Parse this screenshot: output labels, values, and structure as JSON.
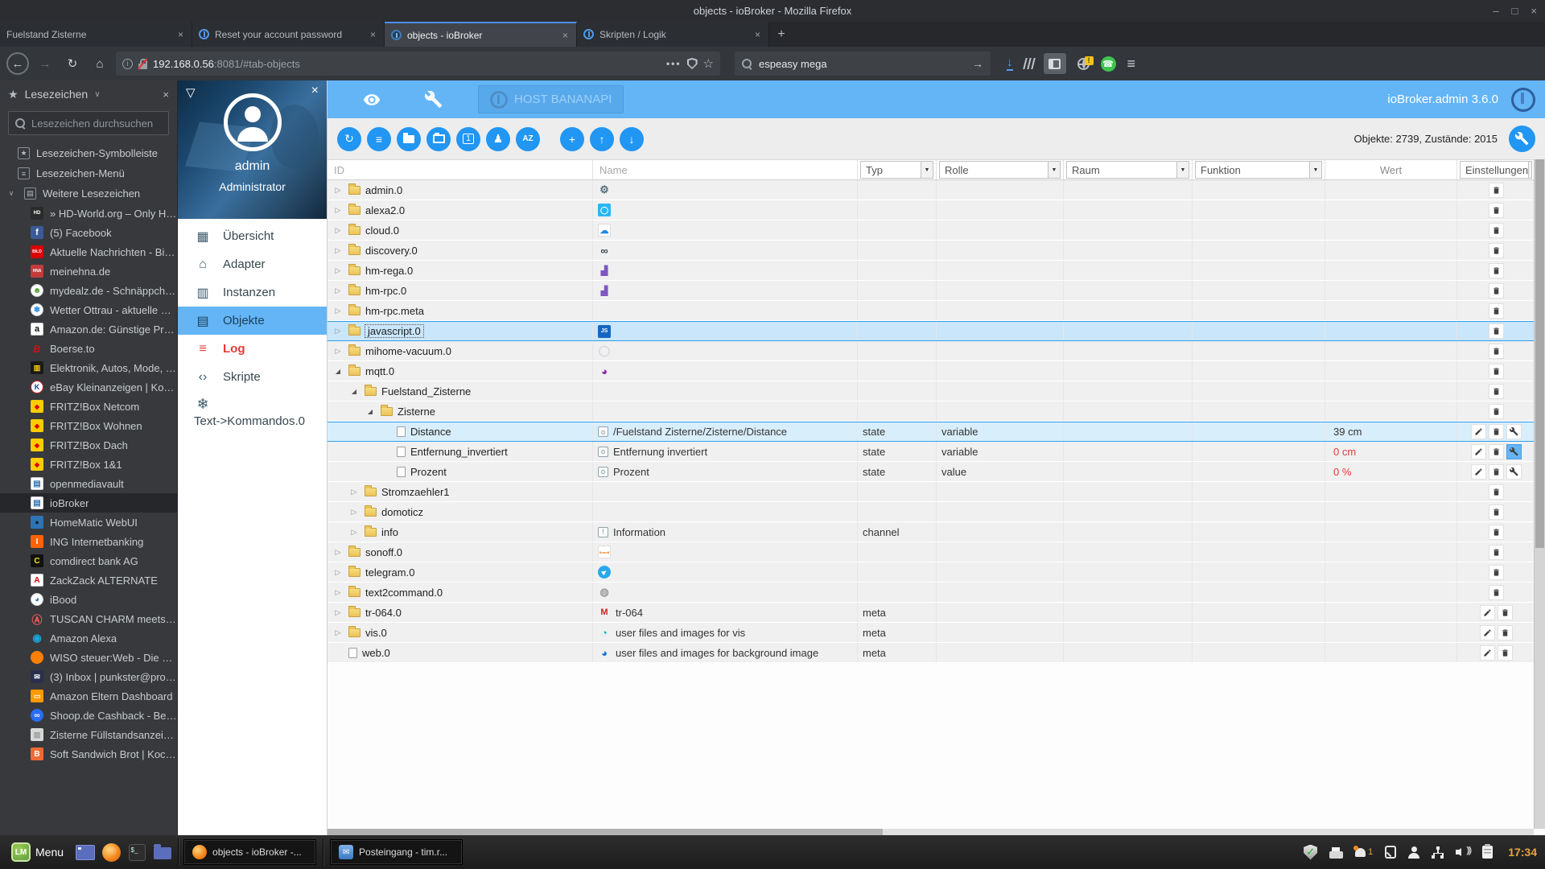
{
  "window": {
    "title": "objects - ioBroker - Mozilla Firefox",
    "controls": {
      "minimize": "–",
      "maximize": "□",
      "close": "×"
    }
  },
  "tabs": [
    {
      "label": "Fuelstand Zisterne",
      "favicon": "none",
      "active": false
    },
    {
      "label": "Reset your account password",
      "favicon": "circle-i-icon",
      "active": false
    },
    {
      "label": "objects - ioBroker",
      "favicon": "iobroker-icon",
      "active": true
    },
    {
      "label": "Skripten / Logik",
      "favicon": "circle-i-icon",
      "active": false
    }
  ],
  "navbar": {
    "url_host": "192.168.0.56",
    "url_rest": ":8081/#tab-objects",
    "search_value": "espeasy mega"
  },
  "bookmarks": {
    "title": "Lesezeichen",
    "search_placeholder": "Lesezeichen durchsuchen",
    "roots": [
      {
        "label": "Lesezeichen-Symbolleiste",
        "icon": "bookmarks-toolbar-icon",
        "glyph": "★",
        "expanded": false
      },
      {
        "label": "Lesezeichen-Menü",
        "icon": "bookmarks-menu-icon",
        "glyph": "≡",
        "expanded": false
      },
      {
        "label": "Weitere Lesezeichen",
        "icon": "other-bookmarks-icon",
        "glyph": "▤",
        "expanded": true
      }
    ],
    "items": [
      {
        "label": "» HD-World.org – Only Hig...",
        "icon": "hdworld-favicon",
        "glyph": "HD",
        "bg": "#2b2b2b",
        "fg": "#ffffff",
        "fs": 6
      },
      {
        "label": "(5) Facebook",
        "icon": "facebook-favicon",
        "glyph": "f",
        "bg": "#3a5a98",
        "fg": "#ffffff",
        "fs": 11
      },
      {
        "label": "Aktuelle Nachrichten - Bild...",
        "icon": "bild-favicon",
        "glyph": "BILD",
        "bg": "#dd0000",
        "fg": "#ffffff",
        "fs": 5
      },
      {
        "label": "meinehna.de",
        "icon": "hna-favicon",
        "glyph": "HNA",
        "bg": "#c23a3a",
        "fg": "#ffffff",
        "fs": 5
      },
      {
        "label": "mydealz.de - Schnäppchen...",
        "icon": "mydealz-favicon",
        "glyph": "☻",
        "bg": "#ffffff",
        "fg": "#5aa02c",
        "shape": "circle",
        "fs": 10,
        "border": "#cccccc"
      },
      {
        "label": "Wetter Ottrau - aktuelle W...",
        "icon": "wetter-ottrau-favicon",
        "glyph": "❄",
        "bg": "#ffffff",
        "fg": "#1e88e5",
        "shape": "circle",
        "fs": 10,
        "border": "#cccccc"
      },
      {
        "label": "Amazon.de: Günstige Prei...",
        "icon": "amazon-favicon",
        "glyph": "a",
        "bg": "#ffffff",
        "fg": "#111111",
        "fs": 11,
        "border": "#cccccc"
      },
      {
        "label": "Boerse.to",
        "icon": "boerse-favicon",
        "glyph": "B",
        "bg": "",
        "fg": "#cc1111",
        "fs": 13,
        "italic": true
      },
      {
        "label": "Elektronik, Autos, Mode, S...",
        "icon": "idealo-favicon",
        "glyph": "▥",
        "bg": "#1a1a1a",
        "fg": "#ffcf00",
        "fs": 9
      },
      {
        "label": "eBay Kleinanzeigen | Kost...",
        "icon": "ebay-kleinanzeigen-favicon",
        "glyph": "K",
        "bg": "#ffffff",
        "fg": "#1b3c8c",
        "shape": "circle",
        "fs": 9,
        "border": "#cc2222"
      },
      {
        "label": "FRITZ!Box Netcom",
        "icon": "fritzbox-favicon",
        "glyph": "◆",
        "bg": "#ffcc00",
        "fg": "#dd0000",
        "fs": 8
      },
      {
        "label": "FRITZ!Box Wohnen",
        "icon": "fritzbox-favicon",
        "glyph": "◆",
        "bg": "#ffcc00",
        "fg": "#dd0000",
        "fs": 8
      },
      {
        "label": "FRITZ!Box Dach",
        "icon": "fritzbox-favicon",
        "glyph": "◆",
        "bg": "#ffcc00",
        "fg": "#dd0000",
        "fs": 8
      },
      {
        "label": "FRITZ!Box 1&1",
        "icon": "fritzbox-favicon",
        "glyph": "◆",
        "bg": "#ffcc00",
        "fg": "#dd0000",
        "fs": 8
      },
      {
        "label": "openmediavault",
        "icon": "openmediavault-favicon",
        "glyph": "▤",
        "bg": "#ffffff",
        "fg": "#2e74b5",
        "fs": 10,
        "border": "#cccccc"
      },
      {
        "label": "ioBroker",
        "icon": "iobroker-favicon",
        "glyph": "▤",
        "bg": "#ffffff",
        "fg": "#2e74b5",
        "fs": 10,
        "border": "#cccccc",
        "selected": true
      },
      {
        "label": "HomeMatic WebUI",
        "icon": "homematic-favicon",
        "glyph": "●",
        "bg": "#2e74b5",
        "fg": "#16222c",
        "fs": 9
      },
      {
        "label": "ING Internetbanking",
        "icon": "ing-favicon",
        "glyph": "I",
        "bg": "#ff6200",
        "fg": "#ffffff",
        "fs": 10
      },
      {
        "label": "comdirect bank AG",
        "icon": "comdirect-favicon",
        "glyph": "C",
        "bg": "#111111",
        "fg": "#ffe600",
        "fs": 10
      },
      {
        "label": "ZackZack ALTERNATE",
        "icon": "zackzack-favicon",
        "glyph": "A",
        "bg": "#ffffff",
        "fg": "#dd0000",
        "fs": 10,
        "border": "#cccccc"
      },
      {
        "label": "iBood",
        "icon": "ibood-favicon",
        "glyph": "◕",
        "bg": "#ffffff",
        "fg": "#3a77c2",
        "shape": "circle",
        "fs": 10,
        "border": "#cccccc"
      },
      {
        "label": "TUSCAN CHARM meets ST...",
        "icon": "airbnb-favicon",
        "glyph": "Ⓐ",
        "bg": "",
        "fg": "#ff5a5f",
        "fs": 13
      },
      {
        "label": "Amazon Alexa",
        "icon": "amazon-alexa-favicon",
        "glyph": "◉",
        "bg": "",
        "fg": "#1ca5dc",
        "fs": 13
      },
      {
        "label": "WISO steuer:Web - Die Ste...",
        "icon": "wiso-favicon",
        "glyph": "",
        "bg": "#ff8000",
        "fg": "#ff8000",
        "shape": "circle",
        "fs": 9
      },
      {
        "label": "(3) Inbox | punkster@prot...",
        "icon": "protonmail-favicon",
        "glyph": "✉",
        "bg": "#29304d",
        "fg": "#ffffff",
        "fs": 9
      },
      {
        "label": "Amazon Eltern Dashboard",
        "icon": "amazon-eltern-favicon",
        "glyph": "▭",
        "bg": "#ff9900",
        "fg": "#ffffff",
        "fs": 9
      },
      {
        "label": "Shoop.de Cashback - Beko...",
        "icon": "shoop-favicon",
        "glyph": "∞",
        "bg": "#2a6df4",
        "fg": "#ffffff",
        "shape": "circle",
        "fs": 10
      },
      {
        "label": "Zisterne Füllstandsanzeige...",
        "icon": "zisterne-favicon",
        "glyph": "▨",
        "bg": "#d7d7d7",
        "fg": "#999999",
        "fs": 9
      },
      {
        "label": "Soft Sandwich Brot | Koch...",
        "icon": "blogger-favicon",
        "glyph": "B",
        "bg": "#f06a35",
        "fg": "#ffffff",
        "fs": 10
      }
    ]
  },
  "drawer": {
    "user": "admin",
    "role": "Administrator",
    "menu": [
      {
        "label": "Übersicht",
        "icon": "overview-icon",
        "glyph": "▦"
      },
      {
        "label": "Adapter",
        "icon": "adapter-icon",
        "glyph": "⌂"
      },
      {
        "label": "Instanzen",
        "icon": "instances-icon",
        "glyph": "▥"
      },
      {
        "label": "Objekte",
        "icon": "objects-icon",
        "glyph": "▤",
        "active": true
      },
      {
        "label": "Log",
        "icon": "log-icon",
        "glyph": "≡",
        "danger": true
      },
      {
        "label": "Skripte",
        "icon": "scripts-icon",
        "glyph": "‹›"
      },
      {
        "label": "Text->Kommandos.0",
        "icon": "snowflake-icon",
        "glyph": "❄",
        "twoline": true
      }
    ]
  },
  "appbar": {
    "host": "HOST BANANAPI",
    "version": "ioBroker.admin 3.6.0"
  },
  "objtoolbar": {
    "stats": "Objekte: 2739, Zustände: 2015",
    "buttons": [
      {
        "name": "refresh-button",
        "glyph": "↻"
      },
      {
        "name": "list-view-button",
        "glyph": "≡"
      },
      {
        "name": "collapse-all-button",
        "folder": "closed"
      },
      {
        "name": "expand-all-button",
        "folder": "open"
      },
      {
        "name": "expand-level-1-button",
        "glyph": "1",
        "boxed": true
      },
      {
        "name": "access-rights-button",
        "glyph": "♟"
      },
      {
        "name": "sort-az-button",
        "glyph": "AZ",
        "az": true
      },
      {
        "name": "add-object-button",
        "glyph": "+",
        "gap": true
      },
      {
        "name": "upload-button",
        "glyph": "↑"
      },
      {
        "name": "download-button",
        "glyph": "↓"
      }
    ]
  },
  "table": {
    "columns": [
      {
        "label": "ID",
        "type": "text"
      },
      {
        "label": "Name",
        "type": "text"
      },
      {
        "label": "Typ",
        "type": "select"
      },
      {
        "label": "Rolle",
        "type": "select"
      },
      {
        "label": "Raum",
        "type": "select"
      },
      {
        "label": "Funktion",
        "type": "select"
      },
      {
        "label": "Wert",
        "type": "label"
      },
      {
        "label": "Einstellungen",
        "type": "select"
      }
    ],
    "rows": [
      {
        "id": "admin.0",
        "level": 0,
        "toggle": "collapsed",
        "node": "folder",
        "icon": {
          "name": "admin-adapter-icon",
          "glyph": "⚙",
          "fg": "#546e7a",
          "shape": "plain",
          "fs": 13
        },
        "actions": [
          "delete"
        ]
      },
      {
        "id": "alexa2.0",
        "level": 0,
        "toggle": "collapsed",
        "node": "folder",
        "icon": {
          "name": "alexa2-adapter-icon",
          "glyph": "◯",
          "fg": "#ffffff",
          "bg": "#29b6f6",
          "shape": "square",
          "fs": 9
        },
        "actions": [
          "delete"
        ]
      },
      {
        "id": "cloud.0",
        "level": 0,
        "toggle": "collapsed",
        "node": "folder",
        "icon": {
          "name": "cloud-adapter-icon",
          "glyph": "☁",
          "fg": "#1e88e5",
          "bg": "#ffffff",
          "border": "#dddddd",
          "shape": "square",
          "fs": 11
        },
        "actions": [
          "delete"
        ]
      },
      {
        "id": "discovery.0",
        "level": 0,
        "toggle": "collapsed",
        "node": "folder",
        "icon": {
          "name": "discovery-adapter-icon",
          "glyph": "∞",
          "fg": "#37474f",
          "shape": "plain",
          "fs": 13
        },
        "actions": [
          "delete"
        ]
      },
      {
        "id": "hm-rega.0",
        "level": 0,
        "toggle": "collapsed",
        "node": "folder",
        "icon": {
          "name": "hm-rega-adapter-icon",
          "glyph": "▟",
          "fg": "#7e57c2",
          "shape": "plain",
          "fs": 11
        },
        "actions": [
          "delete"
        ]
      },
      {
        "id": "hm-rpc.0",
        "level": 0,
        "toggle": "collapsed",
        "node": "folder",
        "icon": {
          "name": "hm-rpc-adapter-icon",
          "glyph": "▟",
          "fg": "#7e57c2",
          "shape": "plain",
          "fs": 11
        },
        "actions": [
          "delete"
        ]
      },
      {
        "id": "hm-rpc.meta",
        "level": 0,
        "toggle": "collapsed",
        "node": "folder",
        "icon": null,
        "actions": [
          "delete"
        ]
      },
      {
        "id": "javascript.0",
        "level": 0,
        "toggle": "collapsed",
        "node": "folder",
        "id_selected": true,
        "highlight": "row",
        "icon": {
          "name": "javascript-adapter-icon",
          "glyph": "JS",
          "fg": "#ffffff",
          "bg": "#1565c0",
          "shape": "square",
          "fs": 7
        },
        "actions": [
          "delete"
        ]
      },
      {
        "id": "mihome-vacuum.0",
        "level": 0,
        "toggle": "collapsed",
        "node": "folder",
        "icon": {
          "name": "mihome-vacuum-adapter-icon",
          "glyph": "◯",
          "fg": "#cfd8dc",
          "shape": "plain",
          "fs": 13
        },
        "actions": [
          "delete"
        ]
      },
      {
        "id": "mqtt.0",
        "level": 0,
        "toggle": "expanded",
        "node": "folder",
        "icon": {
          "name": "mqtt-adapter-icon",
          "glyph": "◕",
          "fg": "#8e24aa",
          "shape": "plain",
          "fs": 13
        },
        "actions": [
          "delete"
        ]
      },
      {
        "id": "Fuelstand_Zisterne",
        "level": 1,
        "toggle": "expanded",
        "node": "folder",
        "icon": null,
        "actions": [
          "delete"
        ]
      },
      {
        "id": "Zisterne",
        "level": 2,
        "toggle": "expanded",
        "node": "folder",
        "icon": null,
        "actions": [
          "delete"
        ]
      },
      {
        "id": "Distance",
        "level": 3,
        "toggle": "none",
        "node": "file",
        "highlight": "state",
        "icon": {
          "name": "state-icon",
          "glyph": "o",
          "shape": "outline"
        },
        "name": "/Fuelstand Zisterne/Zisterne/Distance",
        "typ": "state",
        "rolle": "variable",
        "wert": "39 cm",
        "actions": [
          "edit",
          "delete",
          "config"
        ]
      },
      {
        "id": "Entfernung_invertiert",
        "level": 3,
        "toggle": "none",
        "node": "file",
        "icon": {
          "name": "state-icon",
          "glyph": "o",
          "shape": "outline"
        },
        "name": "Entfernung invertiert",
        "typ": "state",
        "rolle": "variable",
        "wert": "0 cm",
        "wert_red": true,
        "config_active": true,
        "actions": [
          "edit",
          "delete",
          "config"
        ]
      },
      {
        "id": "Prozent",
        "level": 3,
        "toggle": "none",
        "node": "file",
        "icon": {
          "name": "state-icon",
          "glyph": "o",
          "shape": "outline"
        },
        "name": "Prozent",
        "typ": "state",
        "rolle": "value",
        "wert": "0 %",
        "wert_red": true,
        "actions": [
          "edit",
          "delete",
          "config"
        ]
      },
      {
        "id": "Stromzaehler1",
        "level": 1,
        "toggle": "collapsed",
        "node": "folder",
        "icon": null,
        "actions": [
          "delete"
        ]
      },
      {
        "id": "domoticz",
        "level": 1,
        "toggle": "collapsed",
        "node": "folder",
        "icon": null,
        "actions": [
          "delete"
        ]
      },
      {
        "id": "info",
        "level": 1,
        "toggle": "collapsed",
        "node": "folder",
        "icon": {
          "name": "info-channel-icon",
          "glyph": "!",
          "shape": "outline"
        },
        "name": "Information",
        "typ": "channel",
        "actions": [
          "delete"
        ]
      },
      {
        "id": "sonoff.0",
        "level": 0,
        "toggle": "collapsed",
        "node": "folder",
        "icon": {
          "name": "sonoff-adapter-icon",
          "glyph": "Sonoff",
          "fg": "#ef6c00",
          "bg": "#ffffff",
          "border": "#e0e0e0",
          "shape": "square",
          "fs": 4
        },
        "actions": [
          "delete"
        ]
      },
      {
        "id": "telegram.0",
        "level": 0,
        "toggle": "collapsed",
        "node": "folder",
        "icon": {
          "name": "telegram-adapter-icon",
          "glyph": "▶",
          "fg": "#ffffff",
          "bg": "#29a9eb",
          "shape": "circle",
          "fs": 7,
          "rotate": -35
        },
        "actions": [
          "delete"
        ]
      },
      {
        "id": "text2command.0",
        "level": 0,
        "toggle": "collapsed",
        "node": "folder",
        "icon": {
          "name": "text2command-adapter-icon",
          "glyph": "◍",
          "fg": "#9e9e9e",
          "shape": "plain",
          "fs": 13
        },
        "actions": [
          "delete"
        ]
      },
      {
        "id": "tr-064.0",
        "level": 0,
        "toggle": "collapsed",
        "node": "folder",
        "icon": {
          "name": "tr-064-adapter-icon",
          "glyph": "M",
          "fg": "#c62828",
          "shape": "plain",
          "fs": 11,
          "bold": true
        },
        "name": "tr-064",
        "typ": "me​ta",
        "actions": [
          "edit",
          "delete"
        ]
      },
      {
        "id": "vis.0",
        "level": 0,
        "toggle": "collapsed",
        "node": "folder",
        "icon": {
          "name": "vis-adapter-icon",
          "glyph": "◔",
          "fg": "#00acc1",
          "shape": "plain",
          "fs": 13
        },
        "name": "user files and images for vis",
        "typ": "meta",
        "actions": [
          "edit",
          "delete"
        ]
      },
      {
        "id": "web.0",
        "level": 0,
        "toggle": "none",
        "node": "file",
        "icon": {
          "name": "web-adapter-icon",
          "glyph": "◕",
          "fg": "#1976d2",
          "shape": "plain",
          "fs": 13
        },
        "name": "user files and images for background image",
        "typ": "meta",
        "actions": [
          "edit",
          "delete"
        ]
      }
    ]
  },
  "taskbar": {
    "menu_label": "Menu",
    "quick": [
      "show-desktop-icon",
      "firefox-icon",
      "terminal-icon",
      "files-icon"
    ],
    "windows": [
      {
        "label": "objects - ioBroker -...",
        "icon": "firefox-icon"
      },
      {
        "label": "Posteingang - tim.r...",
        "icon": "mail-icon"
      }
    ],
    "tray": [
      "shield-check-icon",
      "printer-icon",
      "notifications-icon",
      "tablet-icon",
      "user-icon",
      "network-icon",
      "volume-icon",
      "clipboard-icon"
    ],
    "notification_count": "1",
    "clock": "17:34"
  }
}
